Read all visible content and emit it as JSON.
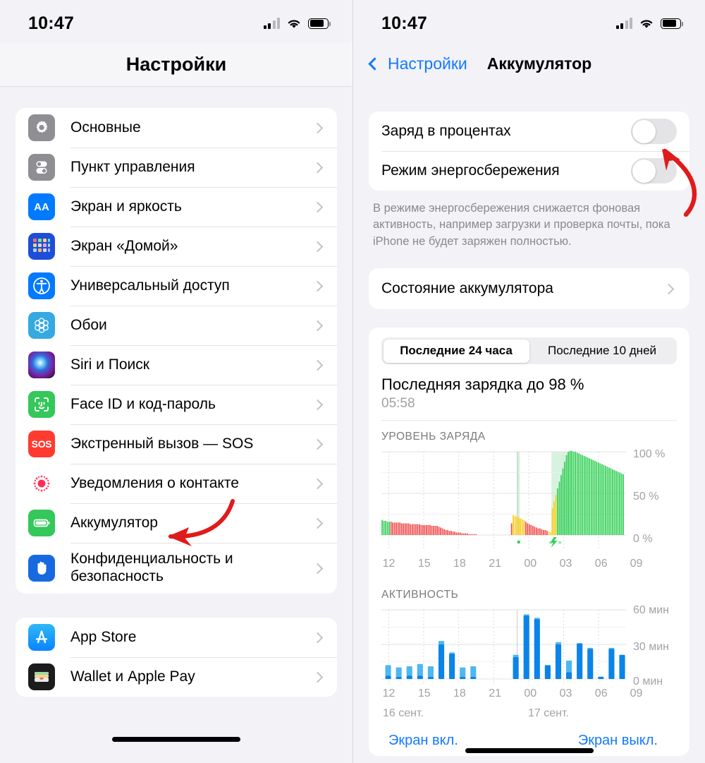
{
  "status_bar": {
    "time": "10:47",
    "signal_icon": "cellular-signal-icon",
    "wifi_icon": "wifi-icon",
    "battery_icon": "battery-icon"
  },
  "left_screen": {
    "title": "Настройки",
    "groups": [
      {
        "items": [
          {
            "label": "Основные",
            "icon": "gear-icon",
            "icon_key": "i-gear"
          },
          {
            "label": "Пункт управления",
            "icon": "control-center-icon",
            "icon_key": "i-cc"
          },
          {
            "label": "Экран и яркость",
            "icon": "display-brightness-icon",
            "icon_key": "i-aa"
          },
          {
            "label": "Экран «Домой»",
            "icon": "home-screen-icon",
            "icon_key": "i-home"
          },
          {
            "label": "Универсальный доступ",
            "icon": "accessibility-icon",
            "icon_key": "i-acc"
          },
          {
            "label": "Обои",
            "icon": "wallpaper-icon",
            "icon_key": "i-wall"
          },
          {
            "label": "Siri и Поиск",
            "icon": "siri-icon",
            "icon_key": "i-siri"
          },
          {
            "label": "Face ID и код-пароль",
            "icon": "face-id-icon",
            "icon_key": "i-face"
          },
          {
            "label": "Экстренный вызов — SOS",
            "icon": "sos-icon",
            "icon_key": "i-sos"
          },
          {
            "label": "Уведомления о контакте",
            "icon": "crash-detection-icon",
            "icon_key": "i-crash"
          },
          {
            "label": "Аккумулятор",
            "icon": "battery-icon",
            "icon_key": "i-batt"
          },
          {
            "label": "Конфиденциальность и безопасность",
            "icon": "privacy-hand-icon",
            "icon_key": "i-priv"
          }
        ]
      },
      {
        "items": [
          {
            "label": "App Store",
            "icon": "app-store-icon",
            "icon_key": "i-appstore"
          },
          {
            "label": "Wallet и Apple Pay",
            "icon": "wallet-icon",
            "icon_key": "i-wallet"
          }
        ]
      }
    ]
  },
  "right_screen": {
    "back_label": "Настройки",
    "title": "Аккумулятор",
    "toggles": [
      {
        "label": "Заряд в процентах",
        "state": "off"
      },
      {
        "label": "Режим энергосбережения",
        "state": "off"
      }
    ],
    "footnote": "В режиме энергосбережения снижается фоновая активность, например загрузки и проверка почты, пока iPhone не будет заряжен полностью.",
    "battery_health_row": "Состояние аккумулятора",
    "segments": [
      {
        "label": "Последние 24 часа",
        "selected": true
      },
      {
        "label": "Последние 10 дней",
        "selected": false
      }
    ],
    "last_charge_title": "Последняя зарядка до 98 %",
    "last_charge_time": "05:58",
    "section_battery_level": "УРОВЕНЬ ЗАРЯДА",
    "section_activity": "АКТИВНОСТЬ",
    "legend": {
      "screen_on": "Экран вкл.",
      "screen_off": "Экран выкл."
    }
  },
  "annotations": {
    "arrow_battery_row": "red-arrow-pointing-to-battery-row",
    "arrow_percentage_toggle": "red-arrow-pointing-to-percentage-toggle",
    "arrow_color": "#e01b1b"
  },
  "colors": {
    "accent_blue": "#1479ff",
    "green": "#34c759",
    "red": "#ff3b30",
    "gray_bg": "#f2f2f7",
    "chart_green": "#34d058",
    "chart_red": "#f05050",
    "chart_yellow": "#ffcc1a",
    "chart_blue_dark": "#0a84e8",
    "chart_blue_light": "#4db8f0"
  },
  "chart_data": [
    {
      "type": "bar",
      "id": "battery-level-chart",
      "title": "УРОВЕНЬ ЗАРЯДА",
      "xlabel": "",
      "ylabel": "%",
      "ylim": [
        0,
        100
      ],
      "ytick_labels": [
        "100 %",
        "50 %",
        "0 %"
      ],
      "yticks": [
        100,
        50,
        0
      ],
      "xtick_labels": [
        "12",
        "15",
        "18",
        "21",
        "00",
        "03",
        "06",
        "09"
      ],
      "grid": true,
      "day_labels": [
        "16 сент.",
        "17 сент."
      ],
      "charging_marker": "charging-bolt-icon",
      "categories": [
        "11:50",
        "12:00",
        "12:10",
        "12:20",
        "12:30",
        "12:40",
        "12:50",
        "13:00",
        "13:10",
        "13:20",
        "13:30",
        "13:40",
        "13:50",
        "14:00",
        "14:10",
        "14:20",
        "14:30",
        "14:40",
        "14:50",
        "15:00",
        "15:10",
        "15:20",
        "15:30",
        "15:40",
        "15:50",
        "16:00",
        "16:10",
        "16:20",
        "16:30",
        "16:40",
        "16:50",
        "17:00",
        "17:10",
        "17:20",
        "17:30",
        "17:40",
        "17:50",
        "18:00",
        "18:10",
        "18:20",
        "18:30",
        "18:40",
        "18:50",
        "19:00",
        "19:10",
        "19:20",
        "19:30",
        "19:40",
        "19:50",
        "20:00",
        "20:10",
        "20:20",
        "20:30",
        "20:40",
        "20:50",
        "21:00",
        "21:10",
        "21:20",
        "21:30",
        "21:40",
        "21:50",
        "22:00",
        "22:10",
        "22:20",
        "22:30",
        "22:40",
        "22:50",
        "23:00",
        "23:10",
        "23:20",
        "23:30",
        "23:40",
        "23:50",
        "00:00",
        "00:10",
        "00:20",
        "00:30",
        "00:40",
        "00:50",
        "01:00",
        "01:10",
        "01:20",
        "01:30",
        "01:40",
        "01:50",
        "02:00",
        "02:10",
        "02:20",
        "02:30",
        "02:40",
        "02:50",
        "03:00",
        "03:10",
        "03:20",
        "03:30",
        "03:40",
        "03:50",
        "04:00",
        "04:10",
        "04:20",
        "04:30",
        "04:40",
        "04:50",
        "05:00",
        "05:10",
        "05:20",
        "05:30",
        "05:40",
        "05:50",
        "06:00",
        "06:10",
        "06:20",
        "06:30",
        "06:40",
        "06:50",
        "07:00",
        "07:10",
        "07:20",
        "07:30",
        "07:40",
        "07:50",
        "08:00",
        "08:10",
        "08:20",
        "08:30",
        "08:40",
        "08:50",
        "09:00",
        "09:10",
        "09:20",
        "09:30",
        "09:40",
        "09:50",
        "10:00",
        "10:10",
        "10:20",
        "10:30",
        "10:40"
      ],
      "values": [
        18,
        17,
        17,
        16,
        16,
        16,
        15,
        15,
        15,
        15,
        15,
        14,
        14,
        14,
        14,
        14,
        13,
        13,
        13,
        13,
        13,
        13,
        12,
        12,
        12,
        12,
        12,
        12,
        11,
        11,
        11,
        11,
        10,
        9,
        8,
        7,
        6,
        6,
        5,
        5,
        4,
        4,
        3,
        3,
        3,
        2,
        2,
        2,
        2,
        1,
        1,
        1,
        1,
        1,
        0,
        0,
        0,
        0,
        0,
        0,
        0,
        0,
        0,
        0,
        0,
        0,
        0,
        0,
        0,
        0,
        0,
        0,
        0,
        14,
        24,
        23,
        22,
        21,
        20,
        19,
        18,
        16,
        14,
        13,
        12,
        11,
        10,
        9,
        8,
        8,
        7,
        6,
        6,
        5,
        4,
        3,
        32,
        40,
        48,
        56,
        64,
        72,
        80,
        88,
        96,
        100,
        101,
        101,
        100,
        100,
        99,
        98,
        97,
        96,
        95,
        94,
        93,
        92,
        91,
        90,
        89,
        88,
        87,
        86,
        85,
        84,
        83,
        82,
        81,
        80,
        79,
        78,
        77,
        76,
        75,
        74,
        73,
        0
      ],
      "bar_colors": [
        "green",
        "green",
        "green",
        "green",
        "green",
        "red",
        "red",
        "red",
        "red",
        "red",
        "red",
        "red",
        "red",
        "red",
        "red",
        "red",
        "red",
        "red",
        "red",
        "red",
        "red",
        "red",
        "red",
        "red",
        "red",
        "red",
        "red",
        "red",
        "red",
        "red",
        "red",
        "red",
        "red",
        "red",
        "red",
        "red",
        "red",
        "red",
        "red",
        "red",
        "red",
        "red",
        "red",
        "red",
        "red",
        "red",
        "red",
        "red",
        "red",
        "red",
        "red",
        "red",
        "red",
        "red",
        "none",
        "none",
        "none",
        "none",
        "none",
        "none",
        "none",
        "none",
        "none",
        "none",
        "none",
        "none",
        "none",
        "none",
        "none",
        "none",
        "none",
        "none",
        "none",
        "red",
        "yellow",
        "yellow",
        "yellow",
        "yellow",
        "yellow",
        "yellow",
        "yellow",
        "red",
        "red",
        "red",
        "red",
        "red",
        "red",
        "red",
        "red",
        "red",
        "red",
        "red",
        "red",
        "red",
        "yellow",
        "yellow",
        "yellow",
        "yellow",
        "yellow",
        "green",
        "green",
        "green",
        "green",
        "green",
        "green",
        "green",
        "green",
        "green",
        "green",
        "green",
        "green",
        "green",
        "green",
        "green",
        "green",
        "green",
        "green",
        "green",
        "green",
        "green",
        "green",
        "green",
        "green",
        "green",
        "green",
        "green",
        "green",
        "green",
        "green",
        "green",
        "green",
        "green",
        "green",
        "green",
        "green",
        "green",
        "green",
        "none"
      ],
      "charging_bands": [
        {
          "start_label": "00:00",
          "color": "light-green"
        },
        {
          "start_label": "03:30",
          "end_label": "04:20",
          "color": "light-green"
        }
      ]
    },
    {
      "type": "bar",
      "id": "activity-chart",
      "title": "АКТИВНОСТЬ",
      "xlabel": "",
      "ylabel": "мин",
      "ylim": [
        0,
        60
      ],
      "ytick_labels": [
        "60 мин",
        "30 мин",
        "0 мин"
      ],
      "yticks": [
        60,
        30,
        0
      ],
      "xtick_labels": [
        "12",
        "15",
        "18",
        "21",
        "00",
        "03",
        "06",
        "09"
      ],
      "day_labels": [
        "16 сент.",
        "17 сент."
      ],
      "grid": true,
      "categories": [
        "12",
        "13",
        "14",
        "15",
        "16",
        "17",
        "18",
        "19",
        "20",
        "21",
        "22",
        "23",
        "00",
        "01",
        "02",
        "03",
        "04",
        "05",
        "06",
        "07",
        "08",
        "09",
        "10"
      ],
      "series": [
        {
          "name": "Экран вкл.",
          "color": "#0a84e8",
          "values": [
            3,
            2,
            3,
            3,
            2,
            30,
            22,
            2,
            2,
            0,
            0,
            0,
            19,
            55,
            52,
            12,
            30,
            6,
            31,
            26,
            2,
            26,
            21
          ]
        },
        {
          "name": "Экран выкл.",
          "color": "#4db8f0",
          "values": [
            9,
            8,
            8,
            10,
            9,
            3,
            1,
            8,
            9,
            0,
            0,
            0,
            2,
            1,
            1,
            0,
            2,
            10,
            0,
            1,
            0,
            1,
            0
          ]
        }
      ]
    }
  ]
}
